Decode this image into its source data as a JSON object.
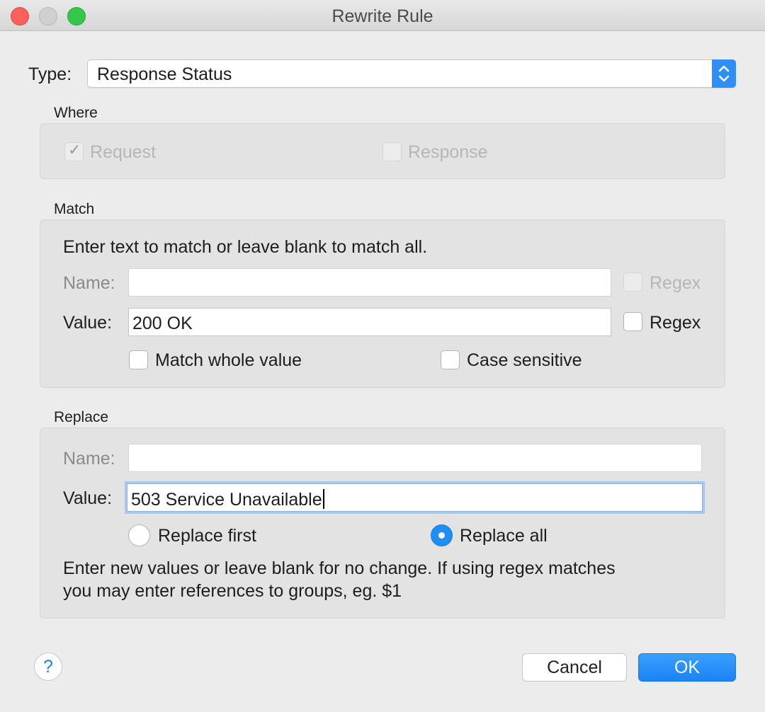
{
  "window": {
    "title": "Rewrite Rule"
  },
  "type": {
    "label": "Type:",
    "value": "Response Status"
  },
  "where": {
    "title": "Where",
    "request_label": "Request",
    "request_checked": true,
    "response_label": "Response",
    "response_checked": false
  },
  "match": {
    "title": "Match",
    "hint": "Enter text to match or leave blank to match all.",
    "name_label": "Name:",
    "name_value": "",
    "name_regex_label": "Regex",
    "value_label": "Value:",
    "value_value": "200 OK",
    "value_regex_label": "Regex",
    "whole_value_label": "Match whole value",
    "case_sensitive_label": "Case sensitive"
  },
  "replace": {
    "title": "Replace",
    "name_label": "Name:",
    "name_value": "",
    "value_label": "Value:",
    "value_value": "503 Service Unavailable",
    "replace_first_label": "Replace first",
    "replace_all_label": "Replace all",
    "selected": "Replace all",
    "hint_line1": "Enter new values or leave blank for no change. If using regex matches",
    "hint_line2": "you may enter references to groups, eg. $1"
  },
  "buttons": {
    "help": "?",
    "cancel": "Cancel",
    "ok": "OK"
  },
  "colors": {
    "accent": "#1f8ef5",
    "close": "#fc605b",
    "maximize": "#34c84a"
  },
  "icons": [
    "close-window-icon",
    "minimize-window-icon",
    "maximize-window-icon",
    "popup-arrows-icon",
    "checkmark-icon",
    "help-icon"
  ]
}
